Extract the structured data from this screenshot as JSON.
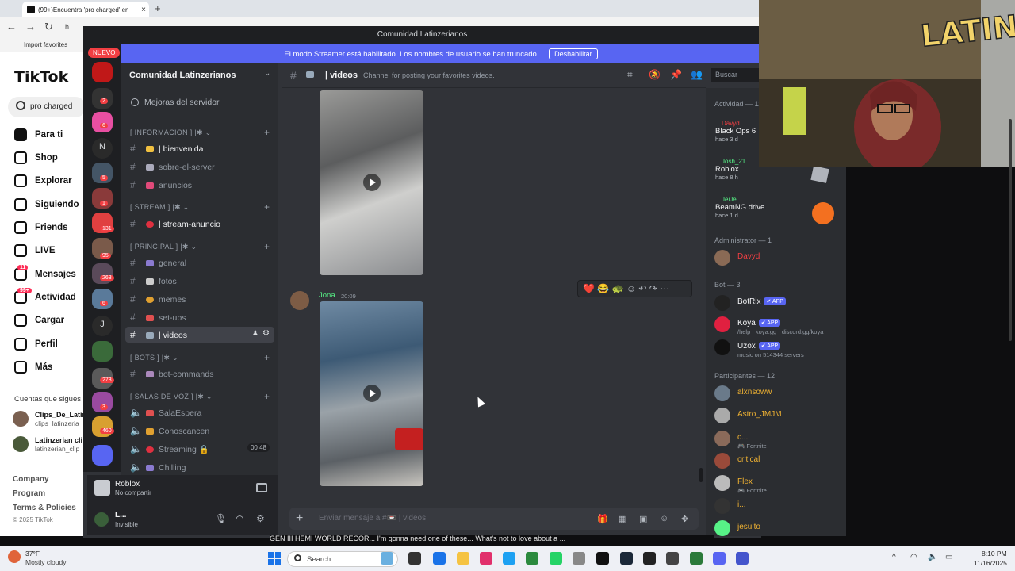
{
  "browser": {
    "tab_title": "(99+)Encuentra 'pro charged' en",
    "tab_close": "×",
    "new_tab": "+",
    "bookmark": "Import favorites",
    "url_fragment": "h"
  },
  "tiktok": {
    "logo": "TikTok",
    "search": "pro charged",
    "nav": [
      {
        "label": "Para ti",
        "icon": "home-icon"
      },
      {
        "label": "Shop",
        "icon": "shop-icon"
      },
      {
        "label": "Explorar",
        "icon": "compass-icon"
      },
      {
        "label": "Siguiendo",
        "icon": "following-icon"
      },
      {
        "label": "Friends",
        "icon": "friends-icon"
      },
      {
        "label": "LIVE",
        "icon": "live-icon"
      },
      {
        "label": "Mensajes",
        "icon": "messages-icon",
        "badge": "11"
      },
      {
        "label": "Actividad",
        "icon": "activity-icon",
        "badge": "99+"
      },
      {
        "label": "Cargar",
        "icon": "upload-icon"
      },
      {
        "label": "Perfil",
        "icon": "profile-icon"
      },
      {
        "label": "Más",
        "icon": "more-icon"
      }
    ],
    "following_header": "Cuentas que sigues",
    "accounts": [
      {
        "name": "Clips_De_Latin",
        "handle": "clips_latinzeria"
      },
      {
        "name": "Latinzerian cli",
        "handle": "latinzerian_clip"
      }
    ],
    "footer": [
      "Company",
      "Program",
      "Terms & Policies"
    ],
    "copyright": "© 2025 TikTok"
  },
  "discord": {
    "window_title": "Comunidad Latinzerianos",
    "streamer_notice": "El modo Streamer está habilitado. Los nombres de usuario se han truncado.",
    "disable_label": "Deshabilitar",
    "new_badge": "NUEVO",
    "guild_badges": [
      "2",
      "6",
      "5",
      "1",
      "131",
      "95",
      "263",
      "6",
      "273",
      "3",
      "460"
    ],
    "guild_letters": [
      "N",
      "J"
    ],
    "server_name": "Comunidad Latinzerianos",
    "boost": "Mejoras del servidor",
    "categories": {
      "info": "[ INFORMACION ] |✱ ⌄",
      "stream": "[ STREAM ] |✱ ⌄",
      "principal": "[ PRINCIPAL ] |✱ ⌄",
      "bots": "[ BOTS ] |✱ ⌄",
      "voice": "[ SALAS DE VOZ ] |✱ ⌄"
    },
    "channels": {
      "bienvenida": "| bienvenida",
      "sobre": "sobre-el-server",
      "anuncios": "anuncios",
      "stream": "| stream-anuncio",
      "general": "general",
      "fotos": "fotos",
      "memes": "memes",
      "setups": "set-ups",
      "videos": "| videos",
      "botcmd": "bot-commands"
    },
    "voice": [
      {
        "label": "SalaEspera"
      },
      {
        "label": "Conoscancen"
      },
      {
        "label": "Streaming 🔒",
        "badge": "00  48"
      },
      {
        "label": "Chilling"
      }
    ],
    "activity": {
      "title": "Roblox",
      "sub": "No compartir"
    },
    "user": {
      "name": "L...",
      "status": "Invisible"
    },
    "chat": {
      "channel": "| videos",
      "topic": "Channel for posting your favorites videos.",
      "search": "Buscar",
      "author": "Jona",
      "time": "20:09",
      "placeholder": "Enviar mensaje a #📼 | videos",
      "reactions": "❤️ 😂 🐢 ☺ ↶ ↷ ⋯"
    },
    "members": {
      "activity_header": "Actividad — 11",
      "activities": [
        {
          "user": "Davyd",
          "game": "Black Ops 6",
          "time": "hace 3 d"
        },
        {
          "user": "Josh_21",
          "game": "Roblox",
          "time": "hace 8 h"
        },
        {
          "user": "JeiJei",
          "game": "BeamNG.drive",
          "time": "hace 1 d"
        }
      ],
      "admin_header": "Administrator — 1",
      "admin": "Davyd",
      "bot_header": "Bot — 3",
      "bots": [
        {
          "name": "BotRix",
          "tag": "✔ APP",
          "sub": ""
        },
        {
          "name": "Koya",
          "tag": "✔ APP",
          "sub": "/help · koya.gg · discord.gg/koya"
        },
        {
          "name": "Uzox",
          "tag": "✔ APP",
          "sub": "music on 514344 servers"
        }
      ],
      "participants_header": "Participantes — 12",
      "participants": [
        {
          "name": "alxnsoww",
          "sub": "",
          "color": "#f0b232"
        },
        {
          "name": "Astro_JMJM",
          "sub": "",
          "color": "#f0b232"
        },
        {
          "name": "c...",
          "sub": "🎮 Fortnite",
          "color": "#f0b232"
        },
        {
          "name": "critical",
          "sub": "",
          "color": "#f0b232"
        },
        {
          "name": "Flex",
          "sub": "🎮 Fortnite",
          "color": "#f0b232"
        },
        {
          "name": "i...",
          "sub": "",
          "color": "#f0b232"
        },
        {
          "name": "jesuito",
          "sub": "",
          "color": "#f0b232"
        }
      ]
    }
  },
  "ticker": "GEN III HEMI WORLD RECOR...     I'm gonna need one of these...     What's not to love about a ...",
  "taskbar": {
    "temp": "37°F",
    "weather": "Mostly cloudy",
    "search": "Search",
    "time": "8:10 PM",
    "date": "11/16/2025"
  }
}
